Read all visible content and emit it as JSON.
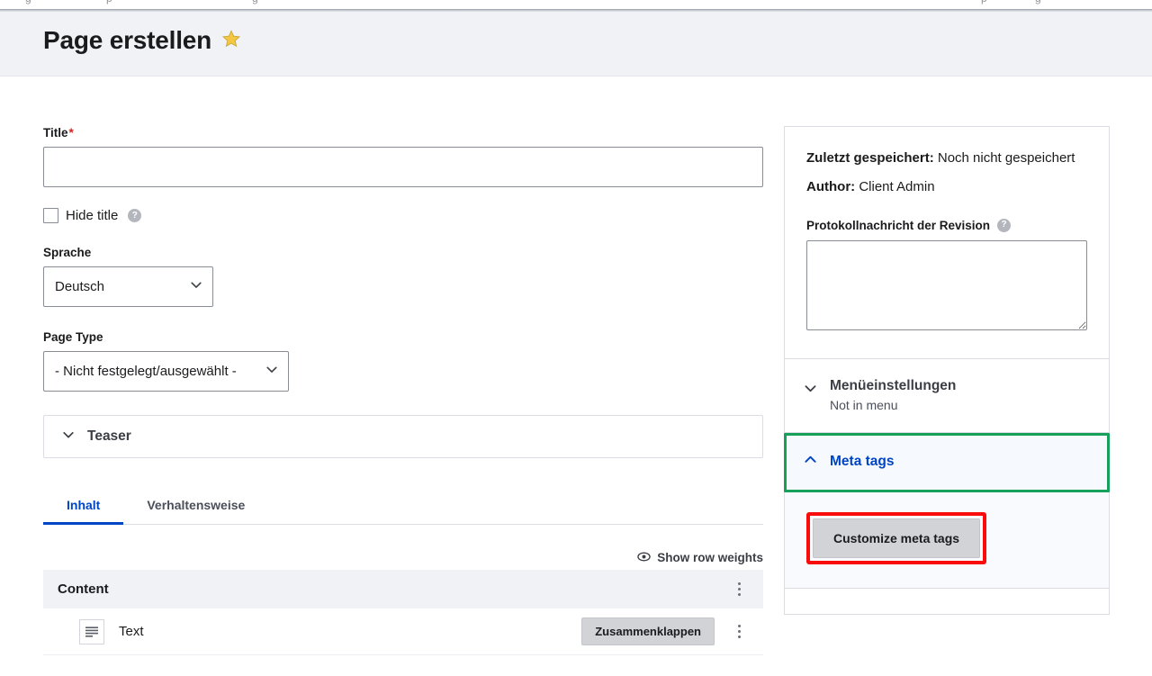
{
  "top_strip": {
    "fragments": [
      "g",
      "p",
      "g",
      "p",
      "g"
    ]
  },
  "header": {
    "title": "Page erstellen",
    "star_icon": "star-icon"
  },
  "form": {
    "title_field": {
      "label": "Title",
      "required_marker": "*",
      "value": "",
      "placeholder": ""
    },
    "hide_title": {
      "label": "Hide title",
      "checked": false,
      "help_icon": "help-icon",
      "help_glyph": "?"
    },
    "language": {
      "label": "Sprache",
      "value": "Deutsch",
      "options": [
        "Deutsch"
      ]
    },
    "page_type": {
      "label": "Page Type",
      "value": "- Nicht festgelegt/ausgewählt -",
      "options": [
        "- Nicht festgelegt/ausgewählt -"
      ]
    },
    "teaser": {
      "label": "Teaser",
      "chevron_icon": "chevron-down-icon",
      "expanded": false
    }
  },
  "tabs": [
    {
      "label": "Inhalt",
      "active": true
    },
    {
      "label": "Verhaltensweise",
      "active": false
    }
  ],
  "content_area": {
    "row_weights_link": "Show row weights",
    "row_weights_icon": "eye-icon",
    "table_header": "Content",
    "header_menu_icon": "kebab-menu-icon",
    "rows": [
      {
        "icon": "text-block-icon",
        "label": "Text",
        "action_label": "Zusammenklappen",
        "menu_icon": "kebab-menu-icon"
      }
    ]
  },
  "sidebar": {
    "meta": {
      "last_saved_label": "Zuletzt gespeichert:",
      "last_saved_value": "Noch nicht gespeichert",
      "author_label": "Author:",
      "author_value": "Client Admin"
    },
    "revision": {
      "label": "Protokollnachricht der Revision",
      "help_icon": "help-icon",
      "help_glyph": "?",
      "value": "",
      "placeholder": ""
    },
    "menu_settings": {
      "title": "Menüeinstellungen",
      "subtitle": "Not in menu",
      "chevron_icon": "chevron-down-icon",
      "expanded": false
    },
    "meta_tags": {
      "title": "Meta tags",
      "chevron_icon": "chevron-up-icon",
      "expanded": true,
      "button_label": "Customize meta tags",
      "highlight_color": "#16a05a",
      "button_highlight_color": "#fb0c0c"
    }
  },
  "colors": {
    "accent": "#0045c4",
    "header_band": "#f1f2f6",
    "required": "#d72222",
    "star": "#f5c642",
    "green_highlight": "#16a05a",
    "red_highlight": "#fb0c0c",
    "button_grey": "#d2d3d7"
  }
}
